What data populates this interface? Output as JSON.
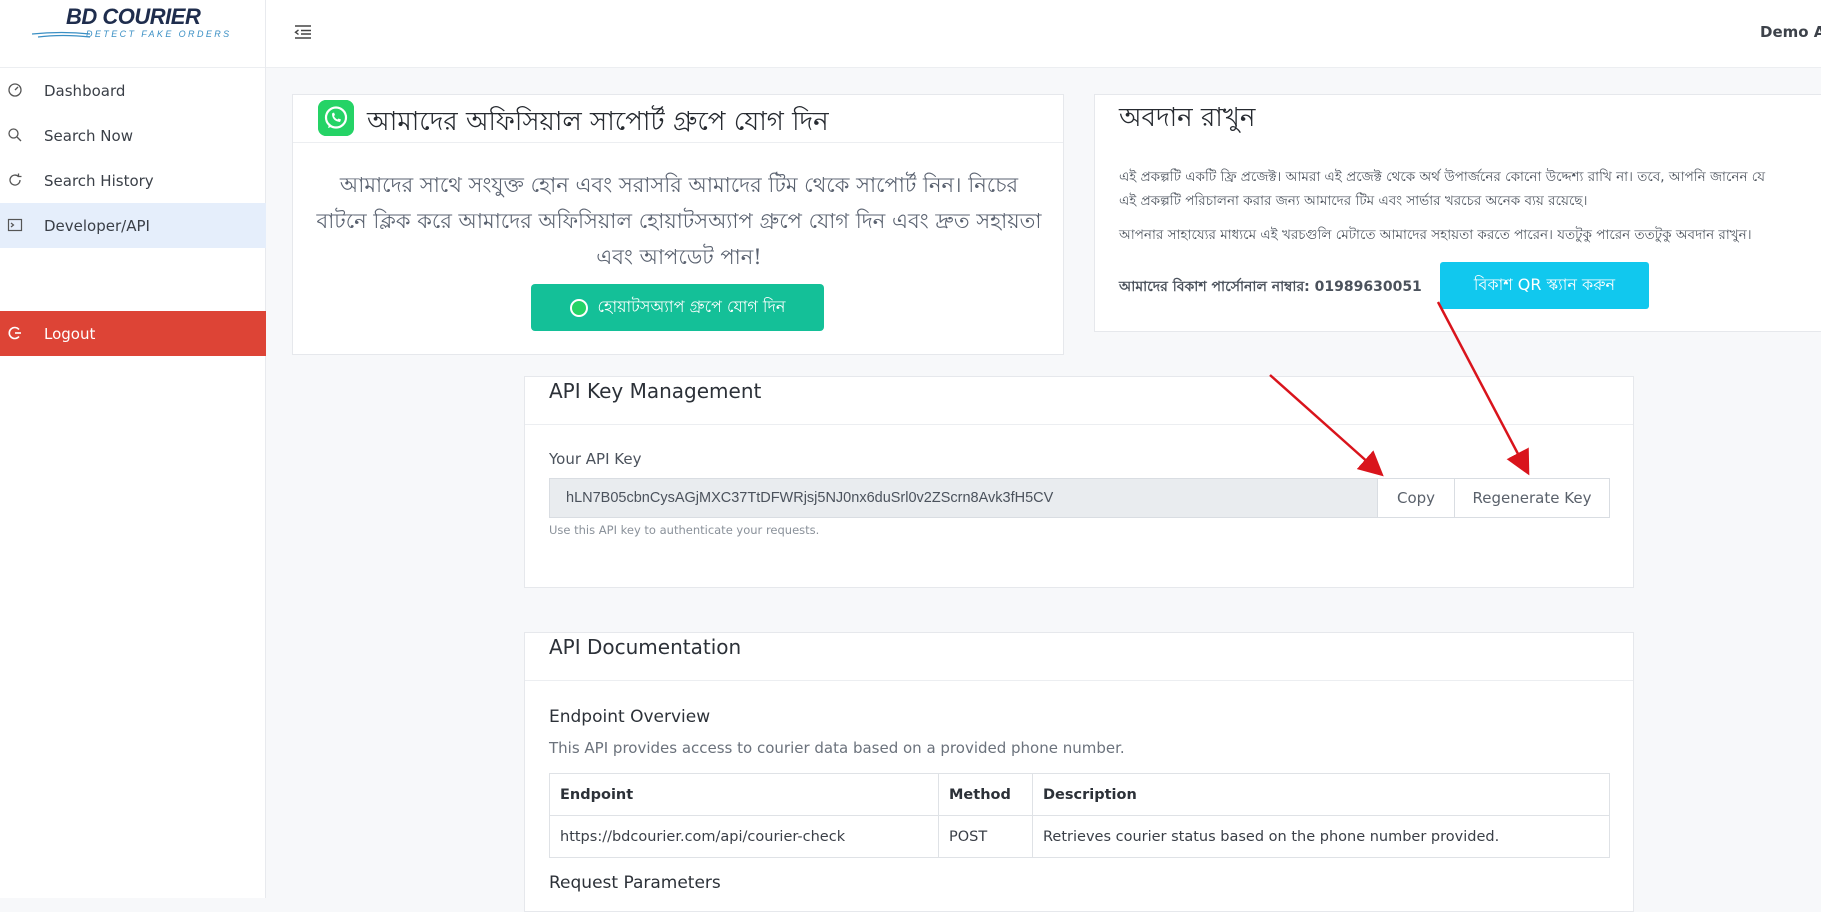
{
  "brand": {
    "name": "BD COURIER",
    "tagline": "DETECT FAKE ORDERS"
  },
  "sidebar": {
    "items": [
      {
        "label": "Dashboard",
        "icon": "gauge-icon"
      },
      {
        "label": "Search Now",
        "icon": "search-icon"
      },
      {
        "label": "Search History",
        "icon": "history-icon"
      },
      {
        "label": "Developer/API",
        "icon": "terminal-icon",
        "active": true
      }
    ],
    "logout": "Logout"
  },
  "header": {
    "user": "Demo Ac"
  },
  "whatsapp": {
    "title": "আমাদের অফিসিয়াল সাপোর্ট গ্রুপে যোগ দিন",
    "text": "আমাদের সাথে সংযুক্ত হোন এবং সরাসরি আমাদের টিম থেকে সাপোর্ট নিন। নিচের বাটনে ক্লিক করে আমাদের অফিসিয়াল হোয়াটসঅ্যাপ গ্রুপে যোগ দিন এবং দ্রুত সহায়তা এবং আপডেট পান!",
    "button": "হোয়াটসঅ্যাপ গ্রুপে যোগ দিন"
  },
  "donation": {
    "title": "অবদান রাখুন",
    "p1_line1": "এই প্রকল্পটি একটি ফ্রি প্রজেক্ট। আমরা এই প্রজেক্ট থেকে অর্থ উপার্জনের কোনো উদ্দেশ্য রাখি না। তবে, আপনি জানেন যে",
    "p1_line2": "এই প্রকল্পটি পরিচালনা করার জন্য আমাদের টিম এবং সার্ভার খরচের অনেক ব্যয় রয়েছে।",
    "p2": "আপনার সাহায্যের মাধ্যমে এই খরচগুলি মেটাতে আমাদের সহায়তা করতে পারেন। যতটুকু পারেন ততটুকু অবদান রাখুন।",
    "phone": "আমাদের বিকাশ পার্সোনাল নাম্বার: 01989630051",
    "button": "বিকাশ QR স্ক্যান করুন"
  },
  "api_key": {
    "section_title": "API Key Management",
    "label": "Your API Key",
    "value": "hLN7B05cbnCysAGjMXC37TtDFWRjsj5NJ0nx6duSrl0v2ZScrn8Avk3fH5CV",
    "copy": "Copy",
    "regenerate": "Regenerate Key",
    "help": "Use this API key to authenticate your requests."
  },
  "docs": {
    "section_title": "API Documentation",
    "overview_title": "Endpoint Overview",
    "overview_desc": "This API provides access to courier data based on a provided phone number.",
    "table": {
      "headers": [
        "Endpoint",
        "Method",
        "Description"
      ],
      "rows": [
        [
          "https://bdcourier.com/api/courier-check",
          "POST",
          "Retrieves courier status based on the phone number provided."
        ]
      ]
    },
    "request_title": "Request Parameters"
  },
  "colors": {
    "accent_active": "#e5eefb",
    "logout": "#dd4436",
    "whatsapp_button": "#14c098",
    "bkash_button": "#11c8ee",
    "annotation_arrow": "#d9141c"
  }
}
